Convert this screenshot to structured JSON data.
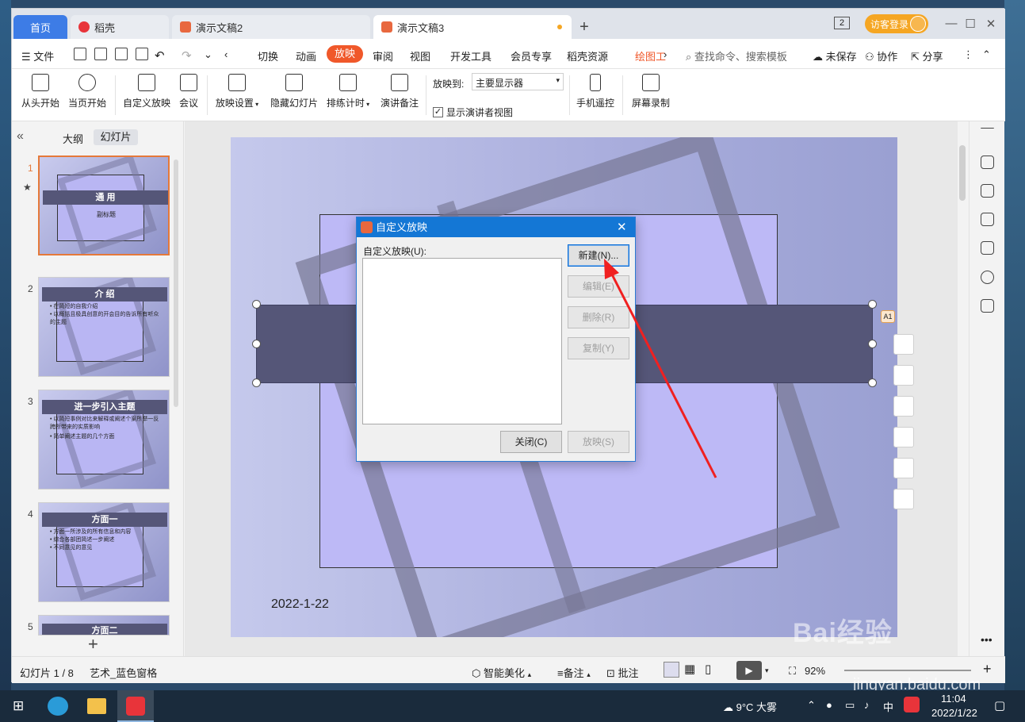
{
  "tabs": {
    "home": "首页",
    "daoke": "稻壳",
    "doc2": "演示文稿2",
    "doc3": "演示文稿3"
  },
  "window": {
    "count": "2",
    "login": "访客登录"
  },
  "menu": {
    "file": "文件",
    "items": [
      "切换",
      "动画",
      "放映",
      "审阅",
      "视图",
      "开发工具",
      "会员专享",
      "稻壳资源",
      "绘图工"
    ],
    "search": "查找命令、搜索模板",
    "unsaved": "未保存",
    "collab": "协作",
    "share": "分享"
  },
  "ribbon": {
    "from_start": "从头开始",
    "from_current": "当页开始",
    "custom_show": "自定义放映",
    "meeting": "会议",
    "show_settings": "放映设置",
    "hide_slide": "隐藏幻灯片",
    "rehearse": "排练计时",
    "notes": "演讲备注",
    "show_to_label": "放映到:",
    "show_to_value": "主要显示器",
    "presenter_view": "显示演讲者视图",
    "phone_remote": "手机遥控",
    "screen_record": "屏幕录制"
  },
  "leftpanel": {
    "outline": "大纲",
    "slides": "幻灯片",
    "thumbs": [
      {
        "num": "1",
        "title": "通 用",
        "subtitle": "副标题"
      },
      {
        "num": "2",
        "title": "介 绍",
        "bullets": [
          "• 在简短的自我介绍",
          "• 以概括且极具创意的开会目的告诉所有听众的主题"
        ]
      },
      {
        "num": "3",
        "title": "进一步引入主题",
        "bullets": [
          "• 以简短事例对比来解释或阐述个案所举一反跨所带来的实质影响",
          "• 简单阐述主题的几个方面"
        ]
      },
      {
        "num": "4",
        "title": "方面一",
        "bullets": [
          "• 方面一所涉及的所有信息和内容",
          "• 综合各部团简述一步阐述",
          "• 不同意见的意见"
        ]
      },
      {
        "num": "5",
        "title": "方面二"
      }
    ]
  },
  "slide": {
    "date": "2022-1-22"
  },
  "dialog": {
    "title": "自定义放映",
    "list_label": "自定义放映(U):",
    "btn_new": "新建(N)...",
    "btn_edit": "编辑(E)",
    "btn_delete": "删除(R)",
    "btn_copy": "复制(Y)",
    "btn_close": "关闭(C)",
    "btn_show": "放映(S)"
  },
  "status": {
    "slide_count": "幻灯片 1 / 8",
    "theme": "艺术_蓝色窗格",
    "beautify": "智能美化",
    "notes": "备注",
    "comments": "批注",
    "zoom": "92%"
  },
  "taskbar": {
    "weather": "9°C 大雾",
    "ime": "中",
    "time": "11:04",
    "date": "2022/1/22"
  },
  "watermark": {
    "main": "Bai经验",
    "url": "jingyan.baidu.com"
  },
  "colors": {
    "accent": "#f0582a",
    "dialog_title": "#1477d5",
    "home_tab": "#3d7ce6"
  }
}
